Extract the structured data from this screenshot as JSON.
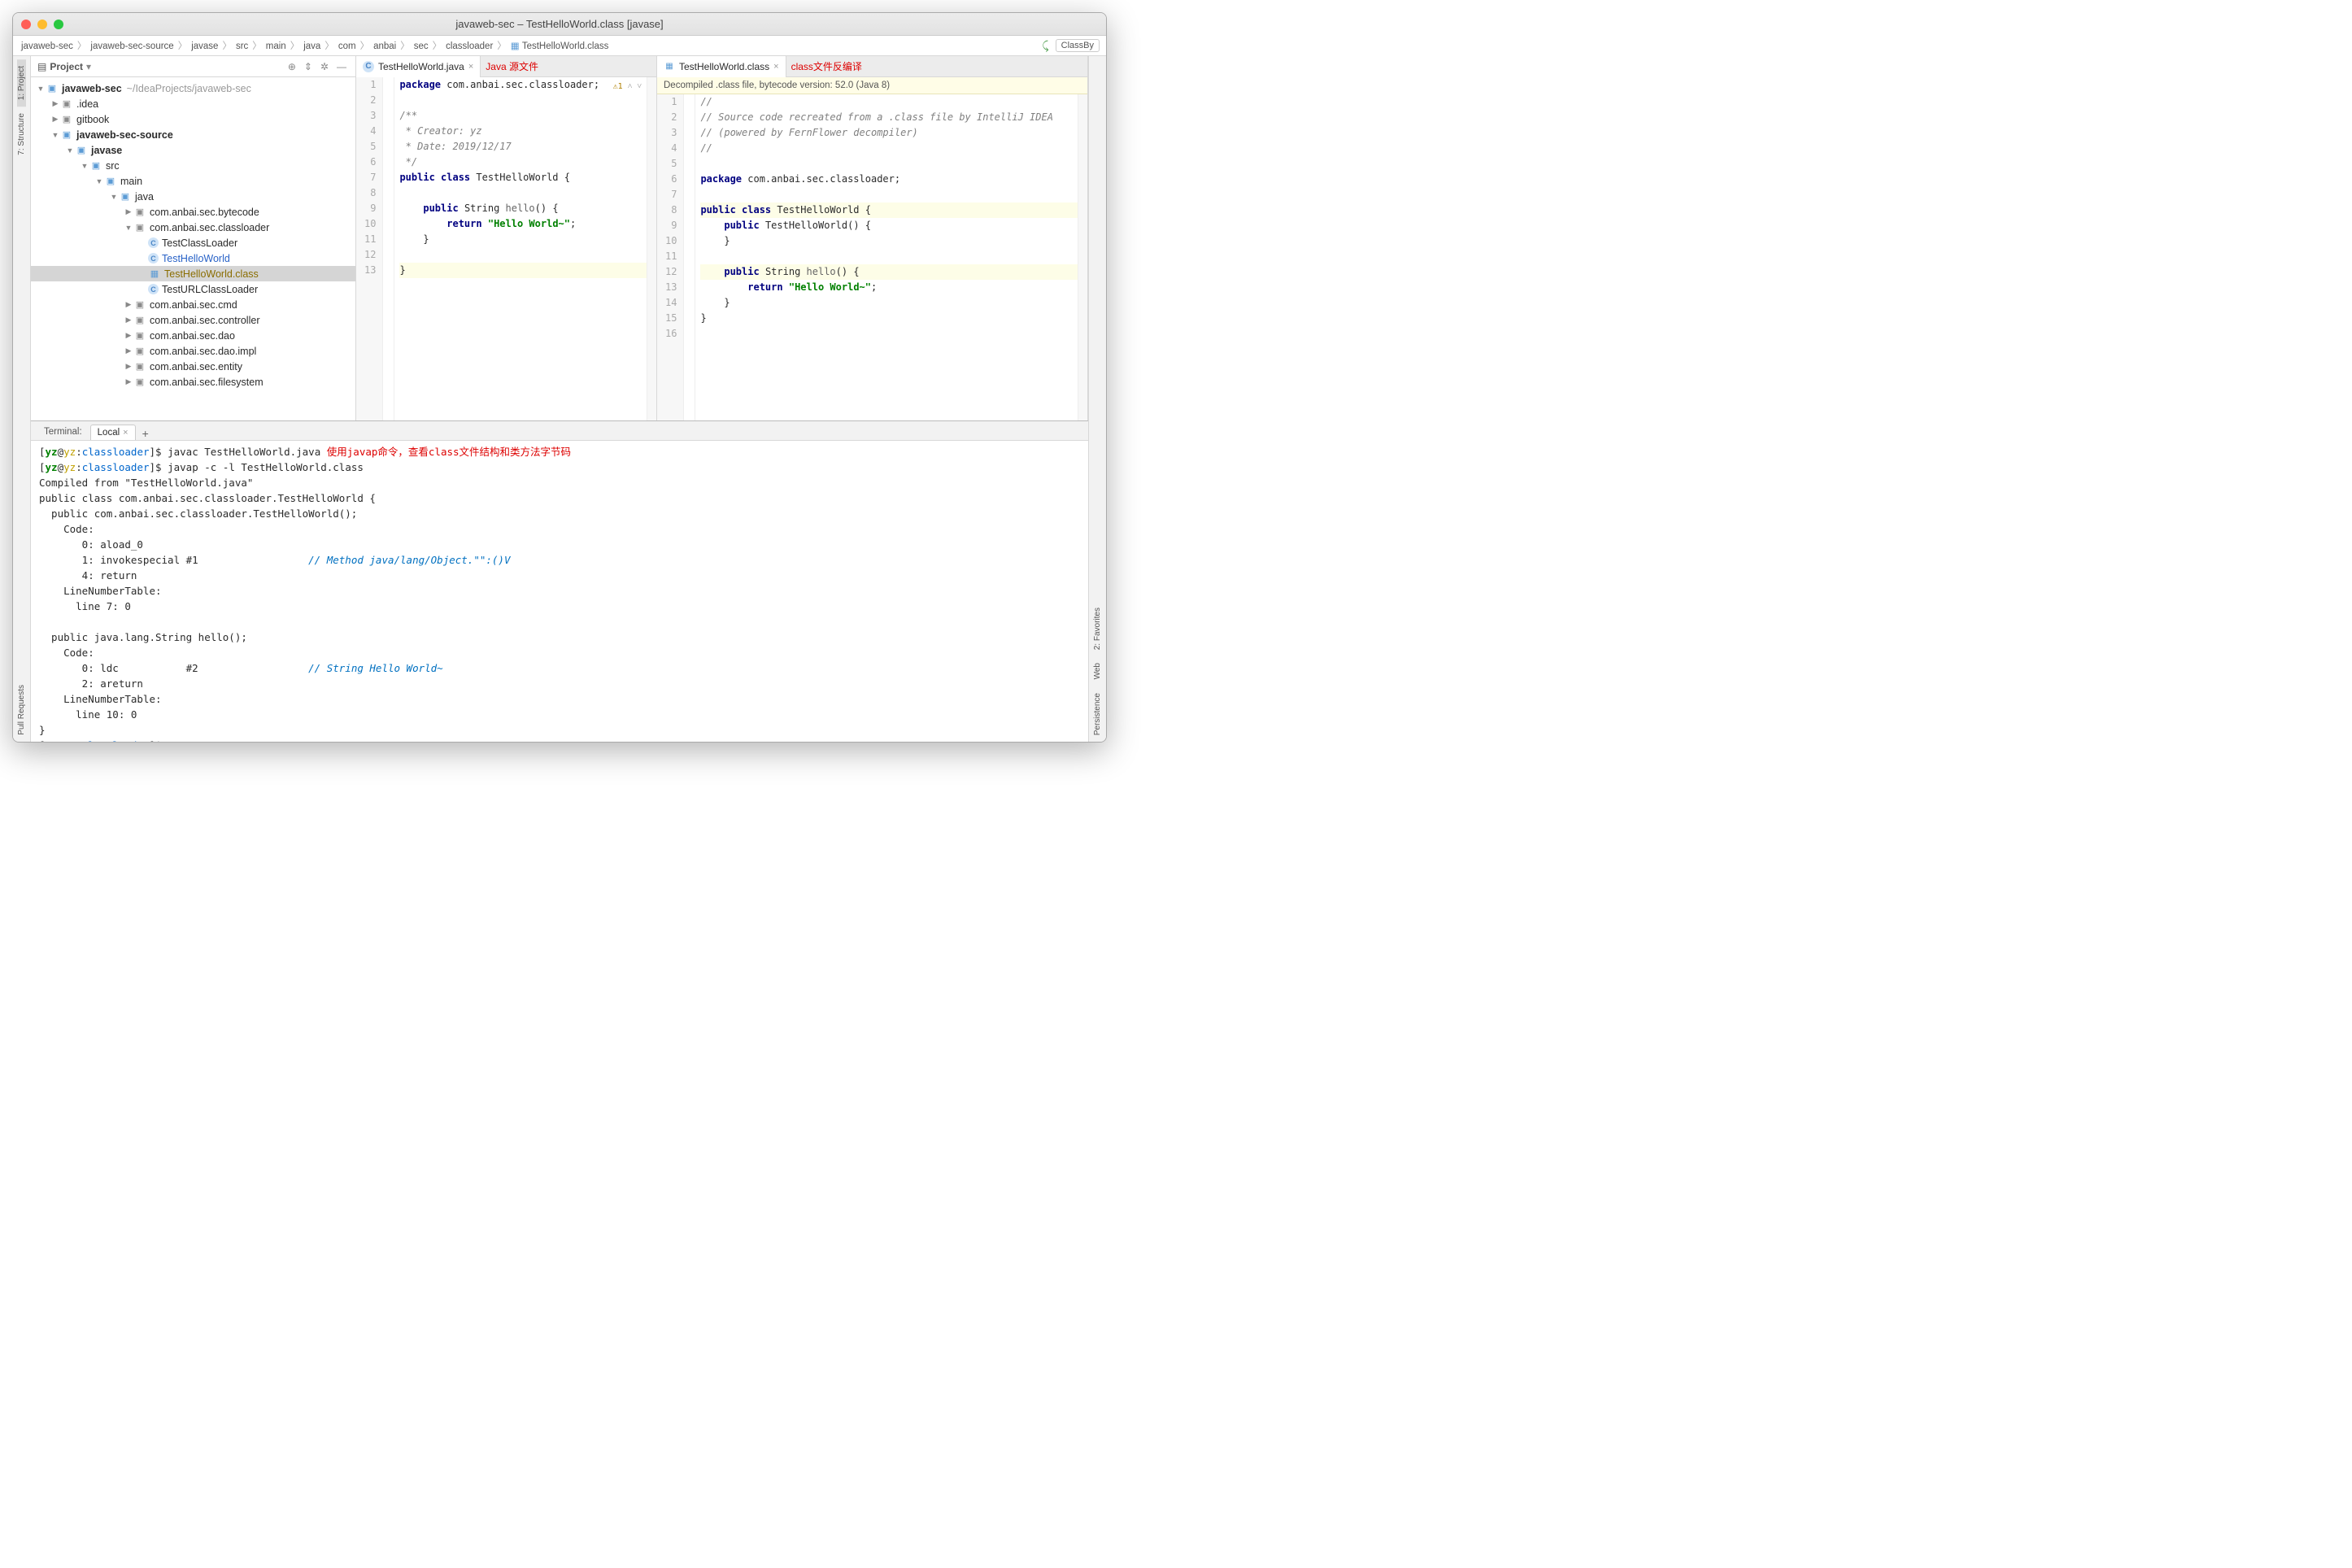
{
  "window": {
    "title": "javaweb-sec – TestHelloWorld.class [javase]"
  },
  "breadcrumb": [
    "javaweb-sec",
    "javaweb-sec-source",
    "javase",
    "src",
    "main",
    "java",
    "com",
    "anbai",
    "sec",
    "classloader",
    "TestHelloWorld.class"
  ],
  "right_btn": "ClassBy",
  "left_gutter": [
    "1: Project",
    "7: Structure",
    "Pull Requests"
  ],
  "right_gutter_bottom": [
    "2: Favorites",
    "Web",
    "Persistence"
  ],
  "project_panel": {
    "title": "Project",
    "root": {
      "name": "javaweb-sec",
      "hint": "~/IdeaProjects/javaweb-sec"
    },
    "nodes": [
      {
        "depth": 1,
        "arrow": "▶",
        "icon": "folder",
        "label": ".idea"
      },
      {
        "depth": 1,
        "arrow": "▶",
        "icon": "folder",
        "label": "gitbook"
      },
      {
        "depth": 1,
        "arrow": "▼",
        "icon": "module",
        "label": "javaweb-sec-source",
        "bold": true
      },
      {
        "depth": 2,
        "arrow": "▼",
        "icon": "module",
        "label": "javase",
        "bold": true
      },
      {
        "depth": 3,
        "arrow": "▼",
        "icon": "folder-src",
        "label": "src"
      },
      {
        "depth": 4,
        "arrow": "▼",
        "icon": "folder-src",
        "label": "main"
      },
      {
        "depth": 5,
        "arrow": "▼",
        "icon": "folder-src",
        "label": "java"
      },
      {
        "depth": 6,
        "arrow": "▶",
        "icon": "pkg",
        "label": "com.anbai.sec.bytecode"
      },
      {
        "depth": 6,
        "arrow": "▼",
        "icon": "pkg",
        "label": "com.anbai.sec.classloader"
      },
      {
        "depth": 7,
        "arrow": "",
        "icon": "java",
        "label": "TestClassLoader"
      },
      {
        "depth": 7,
        "arrow": "",
        "icon": "java",
        "label": "TestHelloWorld",
        "link": true
      },
      {
        "depth": 7,
        "arrow": "",
        "icon": "class",
        "label": "TestHelloWorld.class",
        "selected": true
      },
      {
        "depth": 7,
        "arrow": "",
        "icon": "java",
        "label": "TestURLClassLoader"
      },
      {
        "depth": 6,
        "arrow": "▶",
        "icon": "pkg",
        "label": "com.anbai.sec.cmd"
      },
      {
        "depth": 6,
        "arrow": "▶",
        "icon": "pkg",
        "label": "com.anbai.sec.controller"
      },
      {
        "depth": 6,
        "arrow": "▶",
        "icon": "pkg",
        "label": "com.anbai.sec.dao"
      },
      {
        "depth": 6,
        "arrow": "▶",
        "icon": "pkg",
        "label": "com.anbai.sec.dao.impl"
      },
      {
        "depth": 6,
        "arrow": "▶",
        "icon": "pkg",
        "label": "com.anbai.sec.entity"
      },
      {
        "depth": 6,
        "arrow": "▶",
        "icon": "pkg",
        "label": "com.anbai.sec.filesystem"
      }
    ]
  },
  "editor_left": {
    "tab": "TestHelloWorld.java",
    "annot": "Java 源文件",
    "warn": "⚠1",
    "lines": [
      {
        "n": 1,
        "html": "<span class='kw'>package</span> com.anbai.sec.classloader;"
      },
      {
        "n": 2,
        "html": ""
      },
      {
        "n": 3,
        "html": "<span class='cmt'>/**</span>"
      },
      {
        "n": 4,
        "html": "<span class='cmt'> * Creator: yz</span>"
      },
      {
        "n": 5,
        "html": "<span class='cmt'> * Date: 2019/12/17</span>"
      },
      {
        "n": 6,
        "html": "<span class='cmt'> */</span>"
      },
      {
        "n": 7,
        "html": "<span class='kw'>public class</span> TestHelloWorld {"
      },
      {
        "n": 8,
        "html": ""
      },
      {
        "n": 9,
        "html": "    <span class='kw'>public</span> String <span style='color:#666'>hello</span>() {"
      },
      {
        "n": 10,
        "html": "        <span class='kw'>return</span> <span class='str'>\"Hello World~\"</span>;"
      },
      {
        "n": 11,
        "html": "    }"
      },
      {
        "n": 12,
        "html": ""
      },
      {
        "n": 13,
        "html": "}",
        "hl": true
      }
    ]
  },
  "editor_right": {
    "tab": "TestHelloWorld.class",
    "annot": "class文件反编译",
    "banner": "Decompiled .class file, bytecode version: 52.0 (Java 8)",
    "lines": [
      {
        "n": 1,
        "html": "<span class='cmt'>//</span>"
      },
      {
        "n": 2,
        "html": "<span class='cmt'>// Source code recreated from a .class file by IntelliJ IDEA</span>"
      },
      {
        "n": 3,
        "html": "<span class='cmt'>// (powered by FernFlower decompiler)</span>"
      },
      {
        "n": 4,
        "html": "<span class='cmt'>//</span>"
      },
      {
        "n": 5,
        "html": ""
      },
      {
        "n": 6,
        "html": "<span class='kw'>package</span> com.anbai.sec.classloader;"
      },
      {
        "n": 7,
        "html": ""
      },
      {
        "n": 8,
        "html": "<span class='kw'>public class</span> TestHelloWorld {",
        "hl": true
      },
      {
        "n": 9,
        "html": "    <span class='kw'>public</span> TestHelloWorld() {"
      },
      {
        "n": 10,
        "html": "    }"
      },
      {
        "n": 11,
        "html": ""
      },
      {
        "n": 12,
        "html": "    <span class='kw'>public</span> String <span style='color:#666'>hello</span>() {",
        "hl": true
      },
      {
        "n": 13,
        "html": "        <span class='kw'>return</span> <span class='str'>\"Hello World~\"</span>;"
      },
      {
        "n": 14,
        "html": "    }"
      },
      {
        "n": 15,
        "html": "}"
      },
      {
        "n": 16,
        "html": ""
      }
    ]
  },
  "terminal": {
    "label": "Terminal:",
    "tab": "Local",
    "prompt": {
      "user": "yz",
      "host": "yz",
      "path": "classloader"
    },
    "cmd1": "javac TestHelloWorld.java",
    "note1": "使用javap命令，查看class文件结构和类方法字节码",
    "cmd2": "javap -c -l TestHelloWorld.class",
    "output": [
      "Compiled from \"TestHelloWorld.java\"",
      "public class com.anbai.sec.classloader.TestHelloWorld {",
      "  public com.anbai.sec.classloader.TestHelloWorld();",
      "    Code:",
      "       0: aload_0",
      {
        "text": "       1: invokespecial #1                  ",
        "cmt": "// Method java/lang/Object.\"<init>\":()V"
      },
      "       4: return",
      "    LineNumberTable:",
      "      line 7: 0",
      "",
      "  public java.lang.String hello();",
      "    Code:",
      {
        "text": "       0: ldc           #2                  ",
        "cmt": "// String Hello World~"
      },
      "       2: areturn",
      "    LineNumberTable:",
      "      line 10: 0",
      "}"
    ]
  }
}
